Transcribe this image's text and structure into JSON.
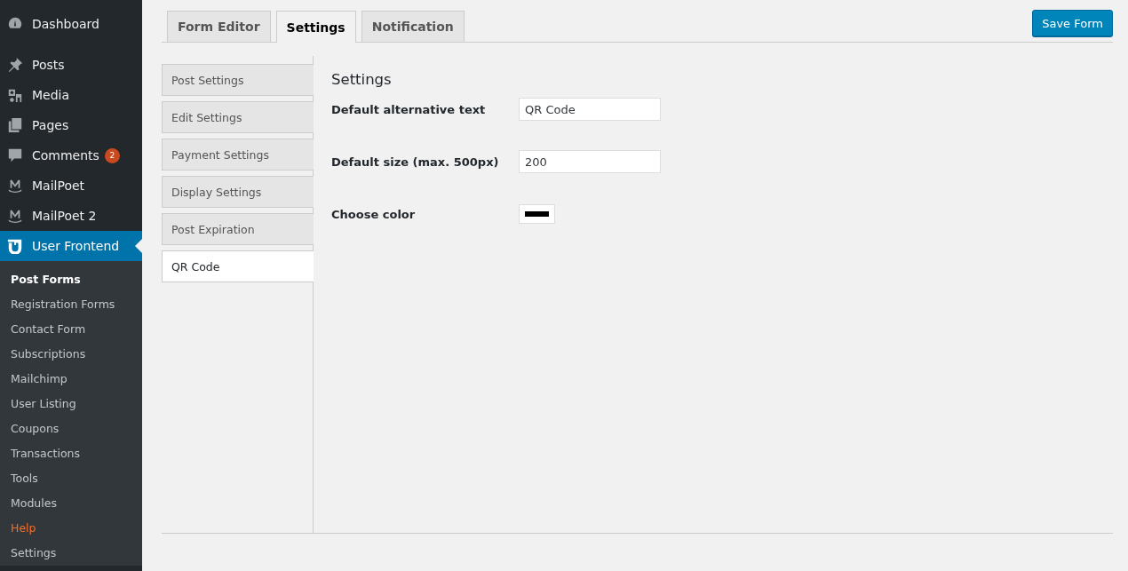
{
  "sidebar": {
    "menu": [
      {
        "label": "Dashboard",
        "kind": "dashboard",
        "selected": false
      },
      {
        "label": "Posts",
        "kind": "pin",
        "selected": false
      },
      {
        "label": "Media",
        "kind": "media",
        "selected": false
      },
      {
        "label": "Pages",
        "kind": "pages",
        "selected": false
      },
      {
        "label": "Comments",
        "kind": "comment",
        "selected": false,
        "badge": "2"
      },
      {
        "label": "MailPoet",
        "kind": "mailpoet",
        "selected": false
      },
      {
        "label": "MailPoet 2",
        "kind": "mailpoet",
        "selected": false
      },
      {
        "label": "User Frontend",
        "kind": "plugin",
        "selected": true
      }
    ],
    "submenu": [
      {
        "label": "Post Forms",
        "selected": true,
        "highlighted": false
      },
      {
        "label": "Registration Forms",
        "selected": false,
        "highlighted": false
      },
      {
        "label": "Contact Form",
        "selected": false,
        "highlighted": false
      },
      {
        "label": "Subscriptions",
        "selected": false,
        "highlighted": false
      },
      {
        "label": "Mailchimp",
        "selected": false,
        "highlighted": false
      },
      {
        "label": "User Listing",
        "selected": false,
        "highlighted": false
      },
      {
        "label": "Coupons",
        "selected": false,
        "highlighted": false
      },
      {
        "label": "Transactions",
        "selected": false,
        "highlighted": false
      },
      {
        "label": "Tools",
        "selected": false,
        "highlighted": false
      },
      {
        "label": "Modules",
        "selected": false,
        "highlighted": false
      },
      {
        "label": "Help",
        "selected": false,
        "highlighted": true
      },
      {
        "label": "Settings",
        "selected": false,
        "highlighted": false
      }
    ]
  },
  "tabs": [
    {
      "label": "Form Editor",
      "selected": false
    },
    {
      "label": "Settings",
      "selected": true
    },
    {
      "label": "Notification",
      "selected": false
    }
  ],
  "save_button": "Save Form",
  "settings_tabs": [
    {
      "label": "Post Settings",
      "selected": false
    },
    {
      "label": "Edit Settings",
      "selected": false
    },
    {
      "label": "Payment Settings",
      "selected": false
    },
    {
      "label": "Display Settings",
      "selected": false
    },
    {
      "label": "Post Expiration",
      "selected": false
    },
    {
      "label": "QR Code",
      "selected": true
    }
  ],
  "panel": {
    "heading": "Settings",
    "fields": [
      {
        "kind": "text",
        "label": "Default alternative text",
        "value": "QR Code"
      },
      {
        "kind": "text",
        "label": "Default size (max. 500px)",
        "value": "200"
      },
      {
        "kind": "color",
        "label": "Choose color",
        "color": "#000000"
      }
    ]
  }
}
